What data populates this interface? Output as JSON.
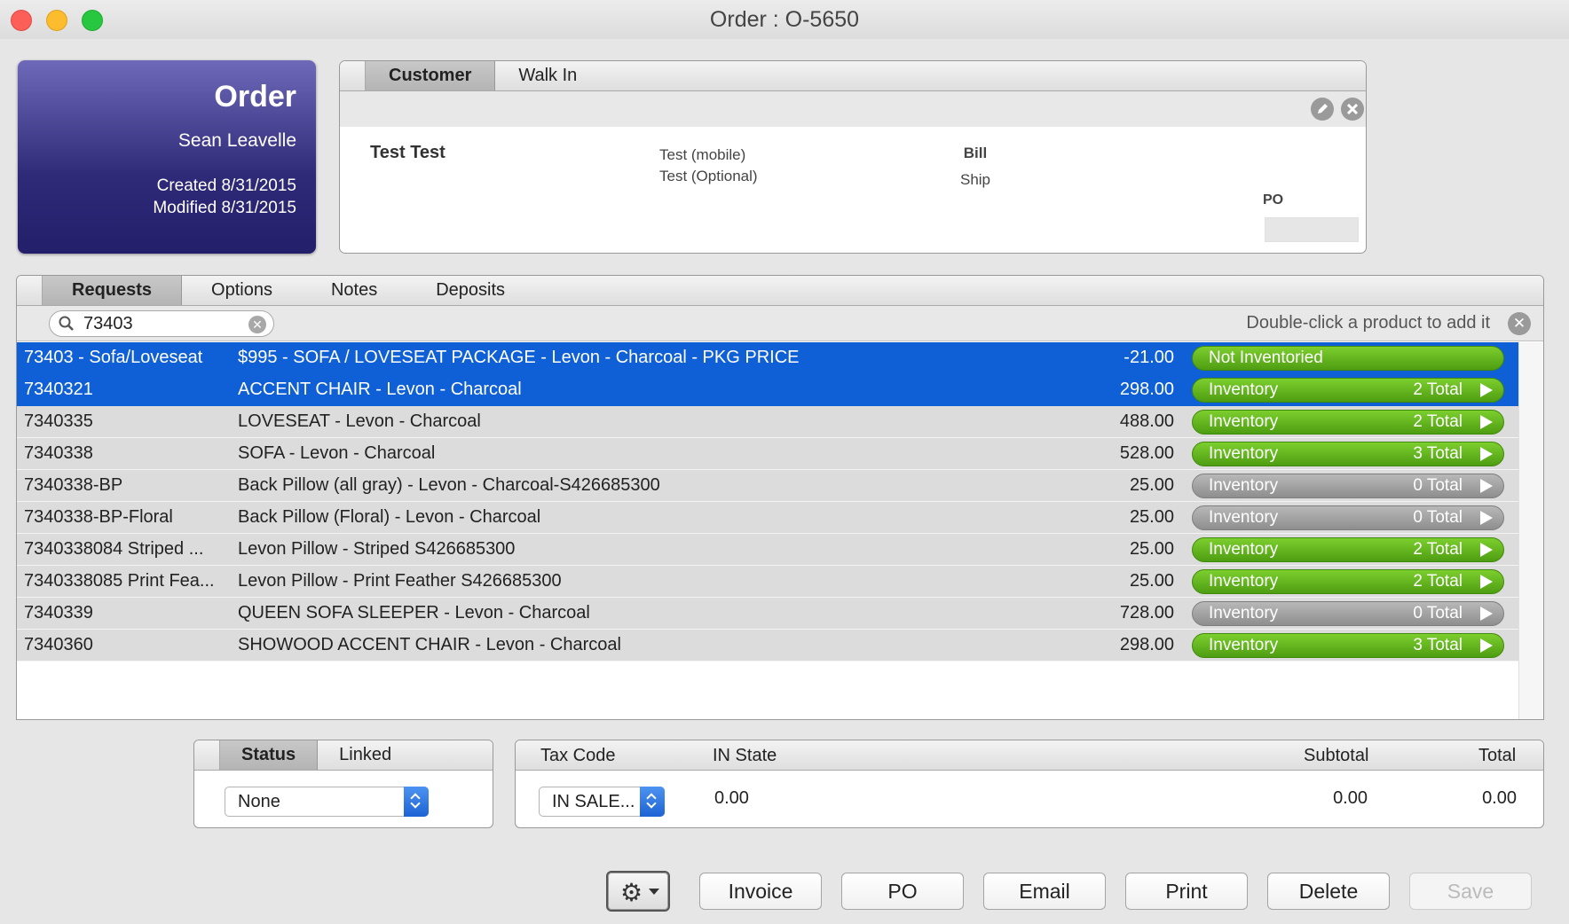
{
  "window": {
    "title": "Order : O-5650"
  },
  "order_card": {
    "title": "Order",
    "salesperson": "Sean Leavelle",
    "created": "Created 8/31/2015",
    "modified": "Modified 8/31/2015"
  },
  "customer_panel": {
    "tabs": [
      "Customer",
      "Walk In"
    ],
    "name": "Test Test",
    "phone_mobile": "Test (mobile)",
    "phone_optional": "Test (Optional)",
    "bill_label": "Bill",
    "ship_label": "Ship",
    "po_label": "PO",
    "po_value": ""
  },
  "requests": {
    "tabs": [
      "Requests",
      "Options",
      "Notes",
      "Deposits"
    ],
    "search_value": "73403",
    "hint": "Double-click a product to add it",
    "rows": [
      {
        "sku": "73403 - Sofa/Loveseat",
        "desc": "$995 - SOFA / LOVESEAT PACKAGE - Levon - Charcoal - PKG PRICE",
        "price": "-21.00",
        "status": "Not Inventoried",
        "total": "",
        "color": "green",
        "selected": true
      },
      {
        "sku": "7340321",
        "desc": "ACCENT CHAIR -  Levon - Charcoal",
        "price": "298.00",
        "status": "Inventory",
        "total": "2 Total",
        "color": "green",
        "selected": true
      },
      {
        "sku": "7340335",
        "desc": "LOVESEAT -  Levon - Charcoal",
        "price": "488.00",
        "status": "Inventory",
        "total": "2 Total",
        "color": "green",
        "selected": false
      },
      {
        "sku": "7340338",
        "desc": "SOFA -  Levon - Charcoal",
        "price": "528.00",
        "status": "Inventory",
        "total": "3 Total",
        "color": "green",
        "selected": false
      },
      {
        "sku": "7340338-BP",
        "desc": "Back Pillow (all gray) - Levon - Charcoal-S426685300",
        "price": "25.00",
        "status": "Inventory",
        "total": "0 Total",
        "color": "gray",
        "selected": false
      },
      {
        "sku": "7340338-BP-Floral",
        "desc": "Back Pillow (Floral) - Levon - Charcoal",
        "price": "25.00",
        "status": "Inventory",
        "total": "0 Total",
        "color": "gray",
        "selected": false
      },
      {
        "sku": "7340338084 Striped ...",
        "desc": "Levon Pillow - Striped S426685300",
        "price": "25.00",
        "status": "Inventory",
        "total": "2 Total",
        "color": "green",
        "selected": false
      },
      {
        "sku": "7340338085 Print Fea...",
        "desc": "Levon Pillow - Print Feather S426685300",
        "price": "25.00",
        "status": "Inventory",
        "total": "2 Total",
        "color": "green",
        "selected": false
      },
      {
        "sku": "7340339",
        "desc": "QUEEN SOFA SLEEPER -  Levon - Charcoal",
        "price": "728.00",
        "status": "Inventory",
        "total": "0 Total",
        "color": "gray",
        "selected": false
      },
      {
        "sku": "7340360",
        "desc": "SHOWOOD ACCENT CHAIR -  Levon - Charcoal",
        "price": "298.00",
        "status": "Inventory",
        "total": "3 Total",
        "color": "green",
        "selected": false
      }
    ]
  },
  "status_panel": {
    "tabs": [
      "Status",
      "Linked"
    ],
    "selected": "None"
  },
  "tax_panel": {
    "tax_code_label": "Tax Code",
    "state_label": "IN State",
    "subtotal_label": "Subtotal",
    "total_label": "Total",
    "tax_code_value": "IN SALE...",
    "state_value": "0.00",
    "subtotal_value": "0.00",
    "total_value": "0.00"
  },
  "actions": {
    "invoice": "Invoice",
    "po": "PO",
    "email": "Email",
    "print": "Print",
    "delete": "Delete",
    "save": "Save"
  },
  "colors": {
    "selection_blue": "#0f5fd6",
    "inventory_green": "#5cad19",
    "inventory_gray": "#9a9a9a",
    "order_card_purple": "#2e2a78"
  }
}
